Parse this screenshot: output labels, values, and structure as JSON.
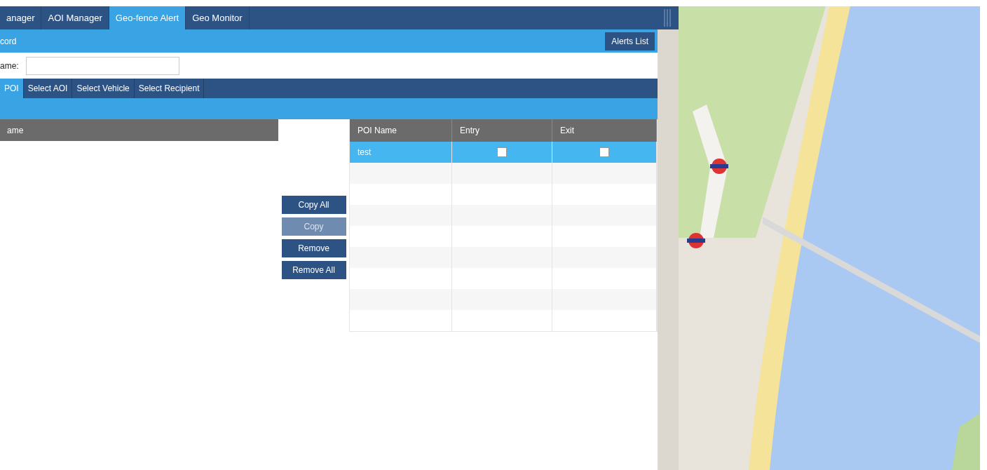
{
  "main_tabs": [
    {
      "label": "anager",
      "selected": false
    },
    {
      "label": "AOI Manager",
      "selected": false
    },
    {
      "label": "Geo-fence Alert",
      "selected": true
    },
    {
      "label": "Geo Monitor",
      "selected": false
    }
  ],
  "record_bar": {
    "title": "cord",
    "button": "Alerts List"
  },
  "name_field": {
    "label": "ame:"
  },
  "sub_tabs": [
    {
      "label": "POI",
      "selected": true
    },
    {
      "label": "Select AOI",
      "selected": false
    },
    {
      "label": "Select Vehicle",
      "selected": false
    },
    {
      "label": "Select Recipient",
      "selected": false
    }
  ],
  "available_table": {
    "columns": [
      "ame"
    ]
  },
  "transfer_buttons": [
    {
      "label": "Copy All",
      "disabled": false
    },
    {
      "label": "Copy",
      "disabled": true
    },
    {
      "label": "Remove",
      "disabled": false
    },
    {
      "label": "Remove All",
      "disabled": false
    }
  ],
  "selected_table": {
    "columns": [
      "POI Name",
      "Entry",
      "Exit"
    ],
    "rows": [
      {
        "name": "test",
        "entry": false,
        "exit": false,
        "selected": true
      }
    ]
  }
}
